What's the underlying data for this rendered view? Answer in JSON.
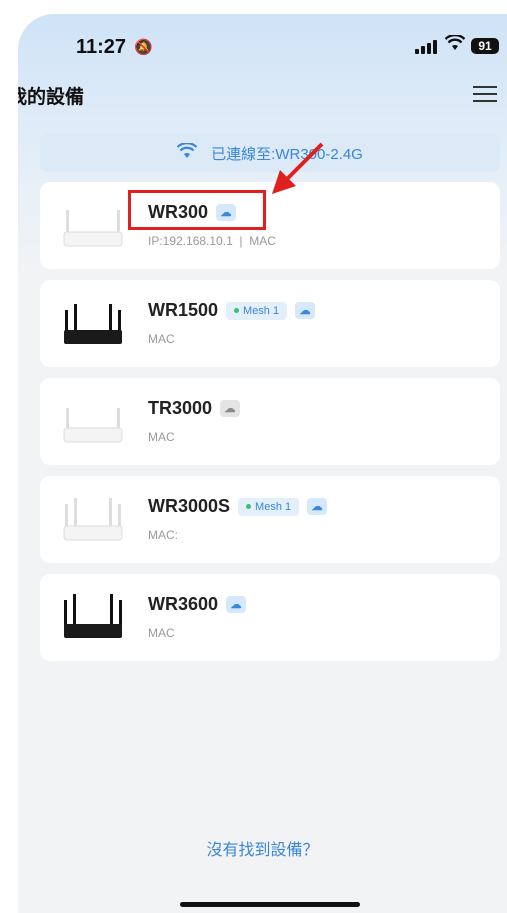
{
  "status": {
    "time": "11:27",
    "battery": "91"
  },
  "header": {
    "title": "我的設備"
  },
  "connection": {
    "prefix": "已連線至:",
    "hidden": "WR",
    "ssid": "300-2.4G"
  },
  "devices": [
    {
      "name": "WR300",
      "sub": "IP:192.168.10.1",
      "sub2": "MAC",
      "cloud": "online",
      "style": "white"
    },
    {
      "name": "WR1500",
      "mesh": "Mesh 1",
      "sub": "MAC",
      "cloud": "online",
      "style": "black"
    },
    {
      "name": "TR3000",
      "sub": "MAC",
      "cloud": "offline",
      "style": "white"
    },
    {
      "name": "WR3000S",
      "mesh": "Mesh 1",
      "sub": "MAC:",
      "cloud": "online",
      "style": "white"
    },
    {
      "name": "WR3600",
      "sub": "MAC",
      "cloud": "online",
      "style": "black"
    }
  ],
  "footer": {
    "not_found": "沒有找到設備？"
  },
  "colors": {
    "accent": "#3a86d9",
    "highlight": "#e02020",
    "mesh_dot": "#35c26b"
  }
}
